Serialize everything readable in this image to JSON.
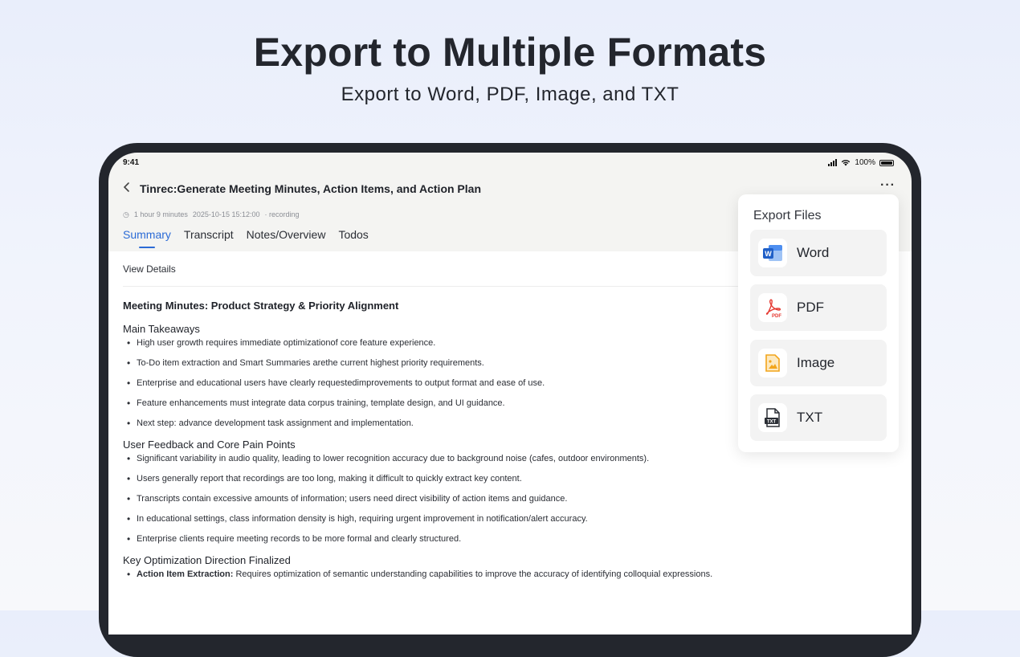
{
  "hero": {
    "title": "Export to Multiple Formats",
    "subtitle": "Export to Word, PDF, Image, and TXT"
  },
  "status_bar": {
    "time": "9:41",
    "battery": "100%"
  },
  "header": {
    "title": "Tinrec:Generate Meeting Minutes, Action Items, and Action Plan",
    "meta": {
      "duration": "1 hour 9 minutes",
      "datetime": "2025-10-15 15:12:00",
      "status": "· recording"
    }
  },
  "tabs": [
    {
      "label": "Summary",
      "active": true
    },
    {
      "label": "Transcript",
      "active": false
    },
    {
      "label": "Notes/Overview",
      "active": false
    },
    {
      "label": "Todos",
      "active": false
    }
  ],
  "content": {
    "view_details": "View Details",
    "doc_title": "Meeting Minutes: Product Strategy & Priority Alignment",
    "sections": [
      {
        "heading": "Main Takeaways",
        "items": [
          "High user growth requires immediate optimizationof core feature experience.",
          "To-Do item extraction and Smart Summaries arethe current highest priority requirements.",
          "Enterprise and educational users have clearly requestedimprovements to output format and ease of use.",
          "Feature enhancements must integrate data corpus training, template design, and UI guidance.",
          "Next step: advance development task assignment and implementation."
        ]
      },
      {
        "heading": "User Feedback and Core Pain Points",
        "items": [
          "Significant variability in audio quality, leading to lower recognition accuracy due to background noise (cafes, outdoor environments).",
          "Users generally report that recordings are too long, making it difficult to quickly extract key content.",
          "Transcripts contain excessive amounts of information; users need direct visibility of action items and guidance.",
          "In educational settings, class information density is high, requiring urgent improvement in notification/alert accuracy.",
          "Enterprise clients require meeting records to be more formal and clearly structured."
        ]
      },
      {
        "heading": "Key Optimization Direction Finalized",
        "items": [
          {
            "bold": "Action Item Extraction:",
            "text": " Requires optimization of semantic understanding capabilities to improve the accuracy of identifying colloquial expressions."
          }
        ]
      }
    ]
  },
  "export_popup": {
    "title": "Export Files",
    "options": [
      {
        "label": "Word",
        "icon": "word-icon",
        "color": "#2b6bd6"
      },
      {
        "label": "PDF",
        "icon": "pdf-icon",
        "color": "#e5372f"
      },
      {
        "label": "Image",
        "icon": "image-icon",
        "color": "#f2a51c"
      },
      {
        "label": "TXT",
        "icon": "txt-icon",
        "color": "#2b2e35"
      }
    ]
  },
  "colors": {
    "accent": "#2b6bd6",
    "device_frame": "#23262d"
  }
}
